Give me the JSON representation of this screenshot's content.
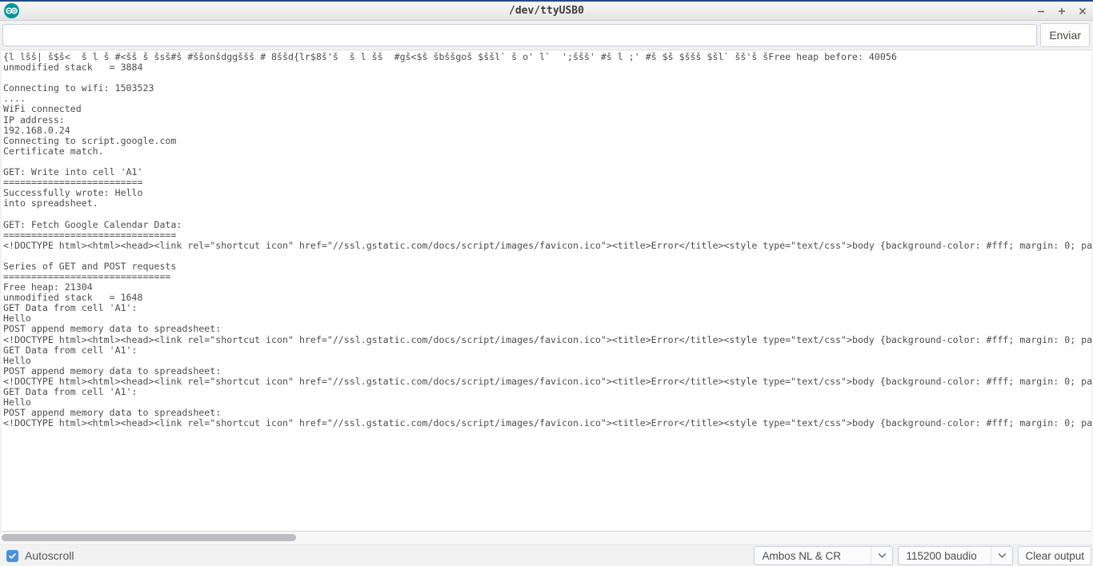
{
  "window": {
    "title": "/dev/ttyUSB0",
    "logo_icon": "arduino-infinity-logo",
    "controls": {
      "minimize": "minimize-icon",
      "maximize": "maximize-icon",
      "close": "close-icon"
    }
  },
  "send_row": {
    "input_value": "",
    "input_placeholder": "",
    "send_label": "Enviar"
  },
  "console": {
    "lines": [
      "{l lšš| š$š<  š l š #<šš š šsš#š #ššonšdggššš # 8ššd{lr$8š'š  š l šš  #gš<$š šbššgoš $ššl` š o' l`  ';ššš' #š l ;' #š $š $ššš $šl` šš'š šFree heap before: 40056",
      "unmodified stack   = 3884",
      "",
      "Connecting to wifi: 1503523",
      "....",
      "WiFi connected",
      "IP address:",
      "192.168.0.24",
      "Connecting to script.google.com",
      "Certificate match.",
      "",
      "GET: Write into cell 'A1'",
      "=========================",
      "Successfully wrote: Hello",
      "into spreadsheet.",
      "",
      "GET: Fetch Google Calendar Data:",
      "===============================",
      "<!DOCTYPE html><html><head><link rel=\"shortcut icon\" href=\"//ssl.gstatic.com/docs/script/images/favicon.ico\"><title>Error</title><style type=\"text/css\">body {background-color: #fff; margin: 0; pa",
      "",
      "Series of GET and POST requests",
      "==============================",
      "Free heap: 21304",
      "unmodified stack   = 1648",
      "GET Data from cell 'A1':",
      "Hello",
      "POST append memory data to spreadsheet:",
      "<!DOCTYPE html><html><head><link rel=\"shortcut icon\" href=\"//ssl.gstatic.com/docs/script/images/favicon.ico\"><title>Error</title><style type=\"text/css\">body {background-color: #fff; margin: 0; pa",
      "GET Data from cell 'A1':",
      "Hello",
      "POST append memory data to spreadsheet:",
      "<!DOCTYPE html><html><head><link rel=\"shortcut icon\" href=\"//ssl.gstatic.com/docs/script/images/favicon.ico\"><title>Error</title><style type=\"text/css\">body {background-color: #fff; margin: 0; pa",
      "GET Data from cell 'A1':",
      "Hello",
      "POST append memory data to spreadsheet:",
      "<!DOCTYPE html><html><head><link rel=\"shortcut icon\" href=\"//ssl.gstatic.com/docs/script/images/favicon.ico\"><title>Error</title><style type=\"text/css\">body {background-color: #fff; margin: 0; pa"
    ]
  },
  "statusbar": {
    "autoscroll_label": "Autoscroll",
    "autoscroll_checked": true,
    "line_ending": "Ambos NL & CR",
    "baud_rate": "115200 baudio",
    "clear_label": "Clear output"
  },
  "colors": {
    "titlebar_accent": "#1f4e87",
    "logo_teal": "#00979c",
    "checkbox_blue": "#4a90e2",
    "console_text": "#4d4d4d",
    "scroll_thumb": "#bcbcc2"
  }
}
